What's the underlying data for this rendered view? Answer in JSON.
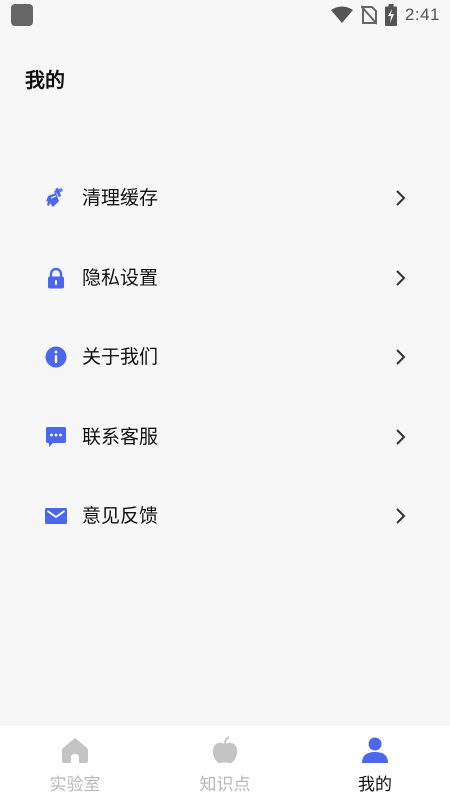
{
  "status_bar": {
    "time": "2:41",
    "icons": [
      "wifi-icon",
      "signal-off-icon",
      "battery-charging-icon"
    ]
  },
  "page": {
    "title": "我的"
  },
  "menu": {
    "items": [
      {
        "label": "清理缓存",
        "icon": "broom-icon"
      },
      {
        "label": "隐私设置",
        "icon": "lock-icon"
      },
      {
        "label": "关于我们",
        "icon": "info-icon"
      },
      {
        "label": "联系客服",
        "icon": "chat-icon"
      },
      {
        "label": "意见反馈",
        "icon": "mail-icon"
      }
    ],
    "accent_color": "#4b67ee"
  },
  "tabs": [
    {
      "label": "实验室",
      "icon": "home-icon",
      "active": false
    },
    {
      "label": "知识点",
      "icon": "apple-icon",
      "active": false
    },
    {
      "label": "我的",
      "icon": "user-icon",
      "active": true
    }
  ],
  "colors": {
    "accent": "#4b67ee",
    "inactive": "#c4c4c4",
    "background": "#f7f7f7"
  }
}
